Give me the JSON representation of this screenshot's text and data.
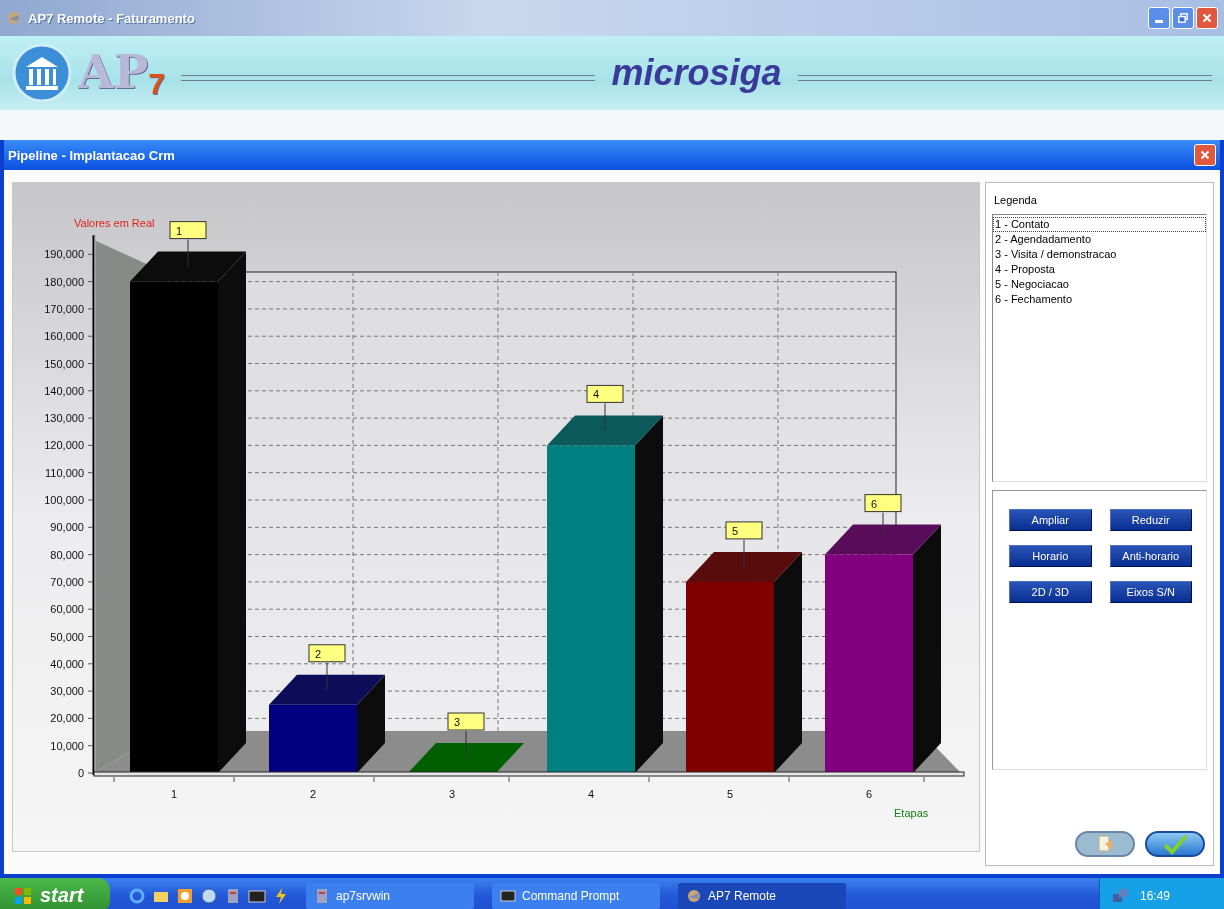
{
  "window": {
    "title": "AP7 Remote - Faturamento"
  },
  "banner": {
    "logo": "AP",
    "logo_suffix": "7",
    "brand": "microsiga"
  },
  "dialog": {
    "title": "Pipeline - Implantacao Crm",
    "chart_data": {
      "type": "bar",
      "ylabel": "Valores em Real",
      "xlabel": "Etapas",
      "categories": [
        "1",
        "2",
        "3",
        "4",
        "5",
        "6"
      ],
      "values": [
        180000,
        25000,
        0,
        120000,
        70000,
        80000
      ],
      "colors": [
        "#000000",
        "#000080",
        "#006000",
        "#008080",
        "#800000",
        "#800080"
      ],
      "annotations": [
        "1",
        "2",
        "3",
        "4",
        "5",
        "6"
      ],
      "grid": true,
      "ylim": [
        0,
        197000
      ],
      "yticks": [
        {
          "value": 0,
          "label": "0"
        },
        {
          "value": 10000,
          "label": "10,000"
        },
        {
          "value": 20000,
          "label": "20,000"
        },
        {
          "value": 30000,
          "label": "30,000"
        },
        {
          "value": 40000,
          "label": "40,000"
        },
        {
          "value": 50000,
          "label": "50,000"
        },
        {
          "value": 60000,
          "label": "60,000"
        },
        {
          "value": 70000,
          "label": "70,000"
        },
        {
          "value": 80000,
          "label": "80,000"
        },
        {
          "value": 90000,
          "label": "90,000"
        },
        {
          "value": 100000,
          "label": "100,000"
        },
        {
          "value": 110000,
          "label": "110,000"
        },
        {
          "value": 120000,
          "label": "120,000"
        },
        {
          "value": 130000,
          "label": "130,000"
        },
        {
          "value": 140000,
          "label": "140,000"
        },
        {
          "value": 150000,
          "label": "150,000"
        },
        {
          "value": 160000,
          "label": "160,000"
        },
        {
          "value": 170000,
          "label": "170,000"
        },
        {
          "value": 180000,
          "label": "180,000"
        },
        {
          "value": 190000,
          "label": "190,000"
        }
      ]
    },
    "legend": {
      "title": "Legenda",
      "items": [
        {
          "label": "1 - Contato",
          "selected": true
        },
        {
          "label": "2 - Agendadamento",
          "selected": false
        },
        {
          "label": "3 - Visita / demonstracao",
          "selected": false
        },
        {
          "label": "4 - Proposta",
          "selected": false
        },
        {
          "label": "5 - Negociacao",
          "selected": false
        },
        {
          "label": "6 - Fechamento",
          "selected": false
        }
      ]
    },
    "buttons": [
      "Ampliar",
      "Reduzir",
      "Horario",
      "Anti-horario",
      "2D / 3D",
      "Eixos S/N"
    ],
    "footer_buttons": [
      {
        "kind": "print",
        "disabled": true
      },
      {
        "kind": "confirm",
        "disabled": false
      }
    ]
  },
  "taskbar": {
    "start": "start",
    "tasks": [
      {
        "label": "ap7srvwin",
        "kind": "server",
        "selected": false
      },
      {
        "label": "Command Prompt",
        "kind": "console",
        "selected": false
      },
      {
        "label": "AP7 Remote",
        "kind": "app",
        "selected": true
      }
    ],
    "clock": "16:49"
  }
}
